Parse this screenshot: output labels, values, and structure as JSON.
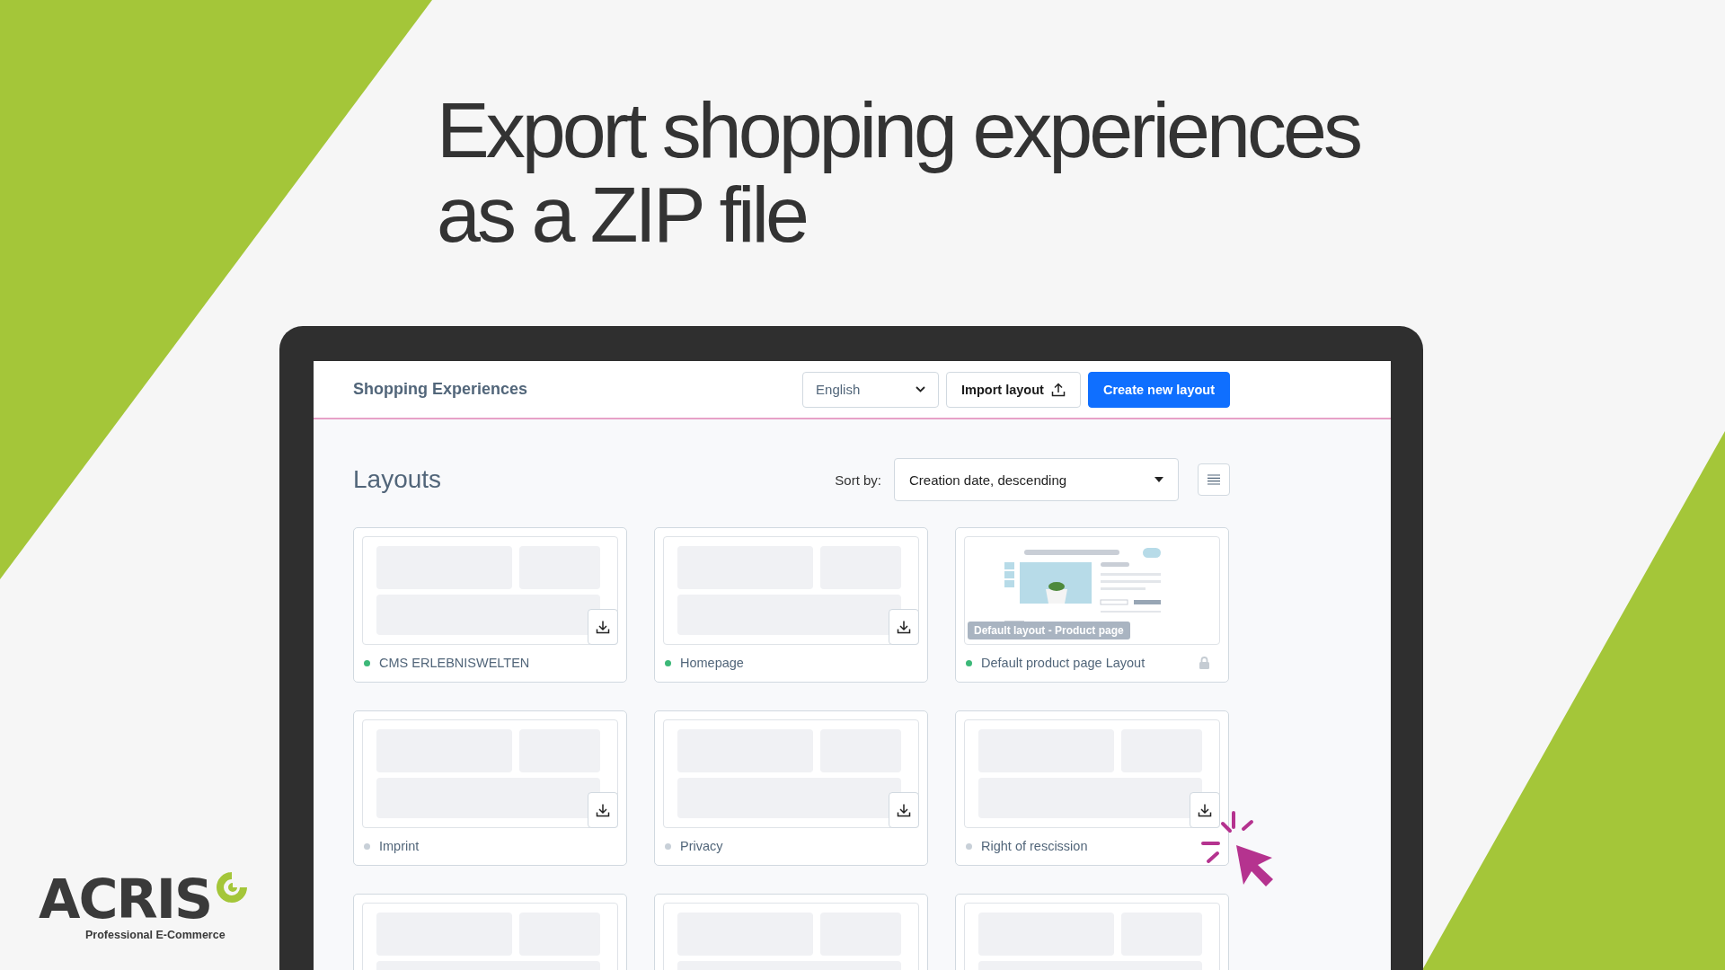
{
  "headline_lines": [
    "Export shopping experiences",
    "as a ZIP file"
  ],
  "header": {
    "title": "Shopping Experiences",
    "language": "English",
    "import_button": "Import layout",
    "create_button": "Create new layout"
  },
  "toolbar": {
    "heading": "Layouts",
    "sort_label": "Sort by:",
    "sort_value": "Creation date, descending"
  },
  "cards": [
    {
      "kind": "blank",
      "name": "CMS ERLEBNISWELTEN",
      "color": "#3cb878",
      "locked": false
    },
    {
      "kind": "blank",
      "name": "Homepage",
      "color": "#3cb878",
      "locked": false
    },
    {
      "kind": "product",
      "name": "Default product page Layout",
      "color": "#3cb878",
      "badge": "Default layout - Product page",
      "locked": true
    },
    {
      "kind": "blank",
      "name": "Imprint",
      "color": "#c8d0d8",
      "locked": false
    },
    {
      "kind": "blank",
      "name": "Privacy",
      "color": "#c8d0d8",
      "locked": false
    },
    {
      "kind": "blank",
      "name": "Right of rescission",
      "color": "#c8d0d8",
      "locked": false
    },
    {
      "kind": "cut"
    },
    {
      "kind": "cut"
    },
    {
      "kind": "cut"
    }
  ],
  "logo": {
    "name": "ACRIS",
    "tagline": "Professional E-Commerce"
  }
}
